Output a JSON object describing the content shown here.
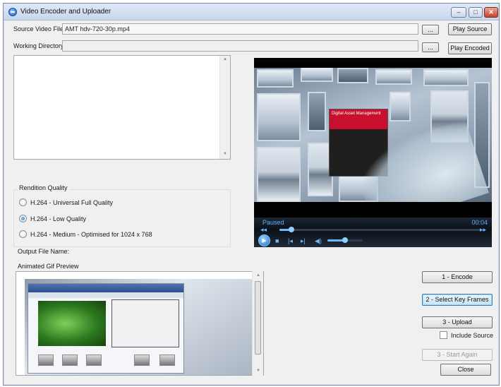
{
  "window": {
    "title": "Video Encoder and Uploader",
    "controls": {
      "minimize": "–",
      "maximize": "□",
      "close": "✕"
    }
  },
  "source": {
    "label": "Source Video File",
    "value": "AMT  hdv-720-30p.mp4",
    "browse_label": "...",
    "play_label": "Play Source"
  },
  "working": {
    "label": "Working Directory",
    "value": "",
    "browse_label": "...",
    "play_label": "Play Encoded"
  },
  "rendition": {
    "group_label": "Rendition Quality",
    "options": [
      {
        "label": "H.264 - Universal Full Quality",
        "checked": false
      },
      {
        "label": "H.264 - Low Quality",
        "checked": true
      },
      {
        "label": "H.264 - Medium - Optimised for 1024 x 768",
        "checked": false
      }
    ]
  },
  "output": {
    "label": "Output File Name:"
  },
  "gif": {
    "label": "Animated Gif Preview"
  },
  "player": {
    "state": "Paused",
    "time": "00:04",
    "seek_fraction": 0.06,
    "volume_fraction": 0.5,
    "video_overlay_text": "Digital Asset Management",
    "accent": "#6ab8ff"
  },
  "actions": {
    "encode": "1 - Encode",
    "key_frames": "2 - Select Key Frames",
    "upload": "3 - Upload",
    "include_source": "Include Source",
    "start_again": "3 - Start Again",
    "close": "Close"
  },
  "icons": {
    "play": "play-icon",
    "stop": "stop-icon",
    "prev": "previous-icon",
    "next": "next-icon",
    "volume": "volume-icon",
    "rewind": "rewind-icon",
    "forward": "forward-icon"
  }
}
